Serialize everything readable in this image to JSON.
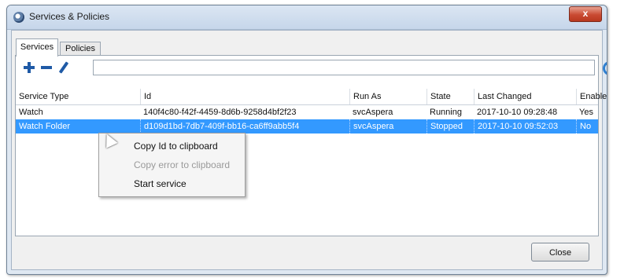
{
  "window": {
    "title": "Services & Policies",
    "close_glyph": "x"
  },
  "tabs": [
    {
      "label": "Services",
      "active": true
    },
    {
      "label": "Policies",
      "active": false
    }
  ],
  "toolbar": {
    "add_icon": "plus-icon",
    "remove_icon": "minus-icon",
    "edit_icon": "pencil-icon",
    "filter_value": "",
    "refresh_icon": "refresh-icon"
  },
  "table": {
    "columns": [
      "Service Type",
      "Id",
      "Run As",
      "State",
      "Last Changed",
      "Enabled"
    ],
    "rows": [
      [
        "Watch",
        "140f4c80-f42f-4459-8d6b-9258d4bf2f23",
        "svcAspera",
        "Running",
        "2017-10-10 09:28:48",
        "Yes"
      ],
      [
        "Watch Folder",
        "d109d1bd-7db7-409f-bb16-ca6ff9abb5f4",
        "svcAspera",
        "Stopped",
        "2017-10-10 09:52:03",
        "No"
      ]
    ],
    "selected_row": 1
  },
  "context_menu": {
    "items": [
      {
        "label": "Copy Id to clipboard",
        "enabled": true
      },
      {
        "label": "Copy error to clipboard",
        "enabled": false
      },
      {
        "label": "Start service",
        "enabled": true
      }
    ]
  },
  "footer": {
    "close_label": "Close"
  },
  "colors": {
    "selection": "#3399ff",
    "toolbar_icon": "#1f5aa6",
    "close_titlebar": "#c94a32"
  }
}
